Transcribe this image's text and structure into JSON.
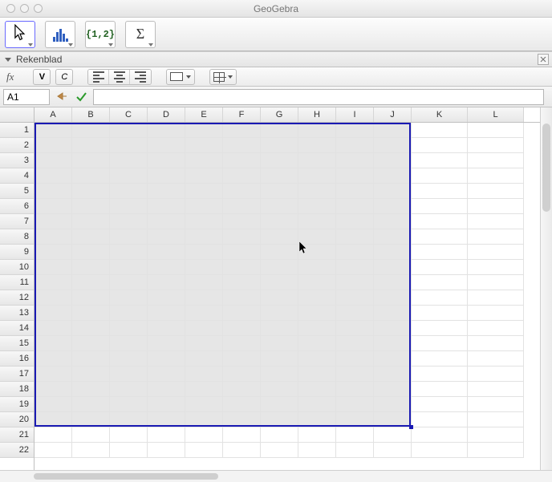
{
  "window": {
    "title": "GeoGebra"
  },
  "toolbar": {
    "tools": [
      {
        "name": "move-tool",
        "icon": "cursor"
      },
      {
        "name": "analysis-tool",
        "icon": "bars"
      },
      {
        "name": "list-tool",
        "icon": "list",
        "label": "{1,2}"
      },
      {
        "name": "sum-tool",
        "icon": "sigma",
        "label": "Σ"
      }
    ]
  },
  "panel": {
    "title": "Rekenblad"
  },
  "formatbar": {
    "fx": "fx",
    "bold": "V",
    "italic": "C"
  },
  "cellref": {
    "value": "A1",
    "formula": ""
  },
  "sheet": {
    "columns": [
      "A",
      "B",
      "C",
      "D",
      "E",
      "F",
      "G",
      "H",
      "I",
      "J",
      "K",
      "L"
    ],
    "rows": [
      1,
      2,
      3,
      4,
      5,
      6,
      7,
      8,
      9,
      10,
      11,
      12,
      13,
      14,
      15,
      16,
      17,
      18,
      19,
      20,
      21,
      22
    ],
    "selection": {
      "from": "A1",
      "to": "J20"
    }
  }
}
